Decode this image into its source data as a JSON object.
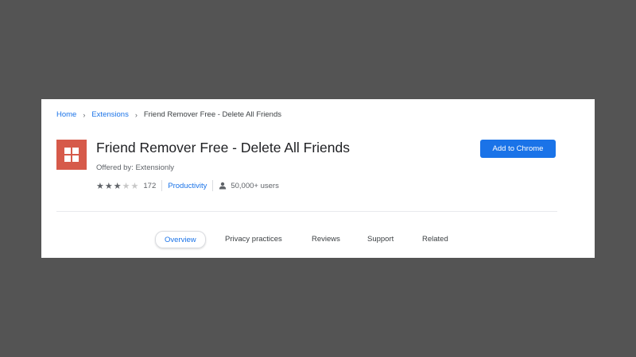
{
  "breadcrumb": {
    "home": "Home",
    "extensions": "Extensions",
    "current": "Friend Remover Free - Delete All Friends",
    "separator": "›"
  },
  "extension": {
    "icon": "grid-icon",
    "icon_color": "#d65a4a",
    "title": "Friend Remover Free - Delete All Friends",
    "offered_by": "Offered by: Extensionly",
    "rating": 3,
    "rating_max": 5,
    "rating_count": "172",
    "category": "Productivity",
    "users": "50,000+ users"
  },
  "actions": {
    "add_label": "Add to Chrome",
    "accent": "#1a73e8"
  },
  "tabs": [
    {
      "label": "Overview",
      "active": true
    },
    {
      "label": "Privacy practices",
      "active": false
    },
    {
      "label": "Reviews",
      "active": false
    },
    {
      "label": "Support",
      "active": false
    },
    {
      "label": "Related",
      "active": false
    }
  ]
}
